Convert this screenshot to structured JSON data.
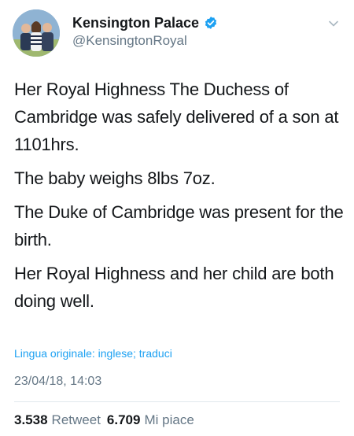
{
  "author": {
    "display_name": "Kensington Palace",
    "handle": "@KensingtonRoyal",
    "verified_icon": "verified-badge-icon",
    "menu_icon": "chevron-down-icon"
  },
  "tweet": {
    "paragraphs": [
      "Her Royal Highness The Duchess of Cambridge was safely delivered of a son at 1101hrs.",
      "The baby weighs 8lbs 7oz.",
      "The Duke of Cambridge was present for the birth.",
      "Her Royal Highness and her child are both doing well."
    ],
    "translate_label": "Lingua originale: inglese; traduci",
    "timestamp": "23/04/18, 14:03"
  },
  "stats": {
    "retweet_count": "3.538",
    "retweet_label": "Retweet",
    "like_count": "6.709",
    "like_label": "Mi piace"
  },
  "colors": {
    "link": "#1da1f2",
    "muted": "#657786",
    "text": "#14171a",
    "verified": "#1da1f2"
  }
}
